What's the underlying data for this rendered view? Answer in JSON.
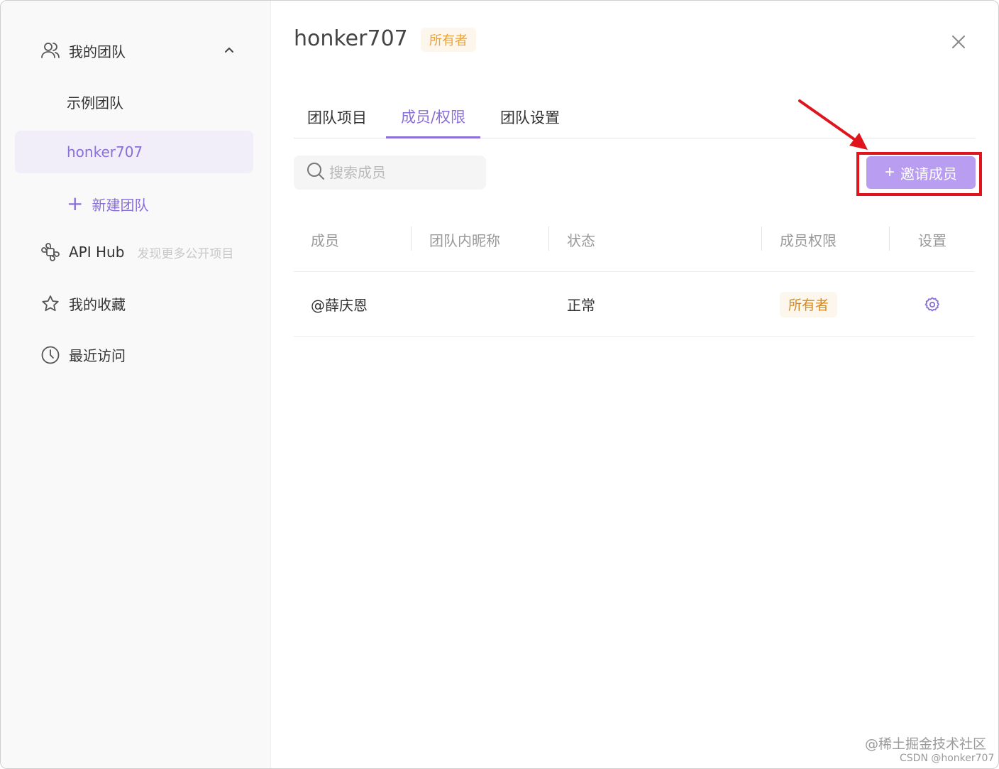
{
  "sidebar": {
    "my_team_label": "我的团队",
    "teams": [
      {
        "label": "示例团队"
      },
      {
        "label": "honker707"
      }
    ],
    "new_team_label": "新建团队",
    "api_hub_label": "API Hub",
    "api_hub_hint": "发现更多公开项目",
    "favorites_label": "我的收藏",
    "recent_label": "最近访问"
  },
  "header": {
    "title": "honker707",
    "role_badge": "所有者"
  },
  "tabs": [
    {
      "label": "团队项目"
    },
    {
      "label": "成员/权限"
    },
    {
      "label": "团队设置"
    }
  ],
  "active_tab": "成员/权限",
  "search": {
    "placeholder": "搜索成员",
    "value": ""
  },
  "invite_button": {
    "label": "邀请成员"
  },
  "table": {
    "columns": [
      "成员",
      "团队内昵称",
      "状态",
      "成员权限",
      "设置"
    ],
    "rows": [
      {
        "member": "@薛庆恩",
        "nickname": "",
        "status": "正常",
        "role": "所有者"
      }
    ]
  },
  "watermark": {
    "line1": "@稀土掘金技术社区",
    "line2": "CSDN @honker707"
  },
  "colors": {
    "accent": "#8a6fd8",
    "invite_button": "#b89df0",
    "highlight_box": "#e0141c",
    "role_badge_bg": "#fdf6ec",
    "role_badge_text": "#e6a23c"
  }
}
